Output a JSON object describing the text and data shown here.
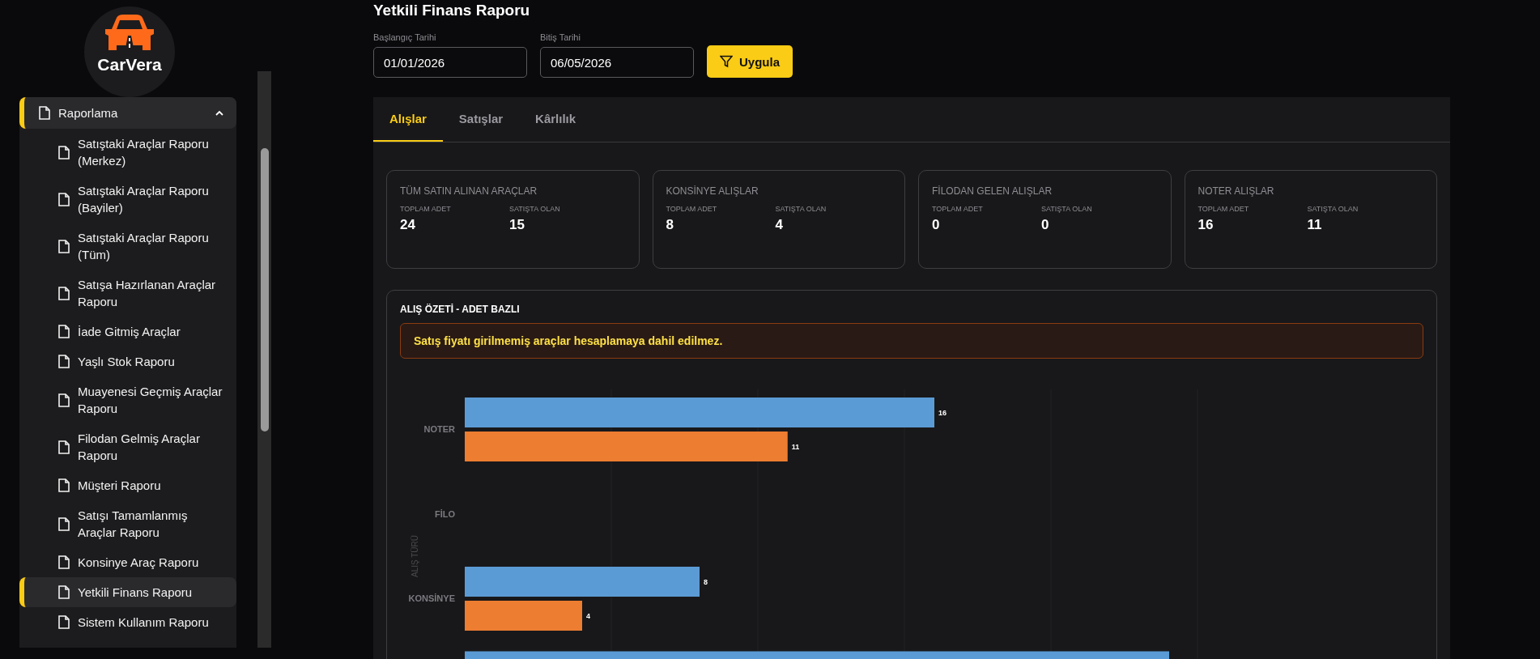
{
  "sidebar": {
    "logo_text": "CarVera",
    "group": {
      "label": "Raporlama",
      "expanded": true
    },
    "items": [
      {
        "label": "Satıştaki Araçlar Raporu (Merkez)",
        "selected": false
      },
      {
        "label": "Satıştaki Araçlar Raporu (Bayiler)",
        "selected": false
      },
      {
        "label": "Satıştaki Araçlar Raporu (Tüm)",
        "selected": false
      },
      {
        "label": "Satışa Hazırlanan Araçlar Raporu",
        "selected": false
      },
      {
        "label": "İade Gitmiş Araçlar",
        "selected": false
      },
      {
        "label": "Yaşlı Stok Raporu",
        "selected": false
      },
      {
        "label": "Muayenesi Geçmiş Araçlar Raporu",
        "selected": false
      },
      {
        "label": "Filodan Gelmiş Araçlar Raporu",
        "selected": false
      },
      {
        "label": "Müşteri Raporu",
        "selected": false
      },
      {
        "label": "Satışı Tamamlanmış Araçlar Raporu",
        "selected": false
      },
      {
        "label": "Konsinye Araç Raporu",
        "selected": false
      },
      {
        "label": "Yetkili Finans Raporu",
        "selected": true
      },
      {
        "label": "Sistem Kullanım Raporu",
        "selected": false
      }
    ]
  },
  "page_title": "Yetkili Finans Raporu",
  "filters": [
    {
      "label": "Başlangıç Tarihi",
      "value": "01/01/2026"
    },
    {
      "label": "Bitiş Tarihi",
      "value": "06/05/2026"
    }
  ],
  "apply_button": "Uygula",
  "tabs": [
    {
      "label": "Alışlar",
      "selected": true
    },
    {
      "label": "Satışlar",
      "selected": false
    },
    {
      "label": "Kârlılık",
      "selected": false
    }
  ],
  "cards": [
    {
      "title": "TÜM SATIN ALINAN ARAÇLAR",
      "stats": [
        {
          "label": "TOPLAM ADET",
          "value": "24"
        },
        {
          "label": "SATIŞTA OLAN",
          "value": "15"
        }
      ]
    },
    {
      "title": "KONSİNYE ALIŞLAR",
      "stats": [
        {
          "label": "TOPLAM ADET",
          "value": "8"
        },
        {
          "label": "SATIŞTA OLAN",
          "value": "4"
        }
      ]
    },
    {
      "title": "FİLODAN GELEN ALIŞLAR",
      "stats": [
        {
          "label": "TOPLAM ADET",
          "value": "0"
        },
        {
          "label": "SATIŞTA OLAN",
          "value": "0"
        }
      ]
    },
    {
      "title": "NOTER ALIŞLAR",
      "stats": [
        {
          "label": "TOPLAM ADET",
          "value": "16"
        },
        {
          "label": "SATIŞTA OLAN",
          "value": "11"
        }
      ]
    }
  ],
  "summary": {
    "title": "ALIŞ ÖZETİ - ADET BAZLI",
    "warning": "Satış fiyatı girilmemiş araçlar hesaplamaya dahil edilmez.",
    "chart_data": {
      "type": "bar",
      "orientation": "horizontal",
      "ylabel": "ALIŞ TÜRÜ",
      "categories": [
        "NOTER",
        "FİLO",
        "KONSİNYE",
        null
      ],
      "series": [
        {
          "color": "#5b9bd5",
          "values": [
            16,
            0,
            8,
            24
          ],
          "value_labels": [
            "16",
            null,
            "8",
            null
          ]
        },
        {
          "color": "#ed7d31",
          "values": [
            11,
            0,
            4,
            null
          ],
          "value_labels": [
            "11",
            null,
            "4",
            null
          ]
        }
      ]
    }
  }
}
